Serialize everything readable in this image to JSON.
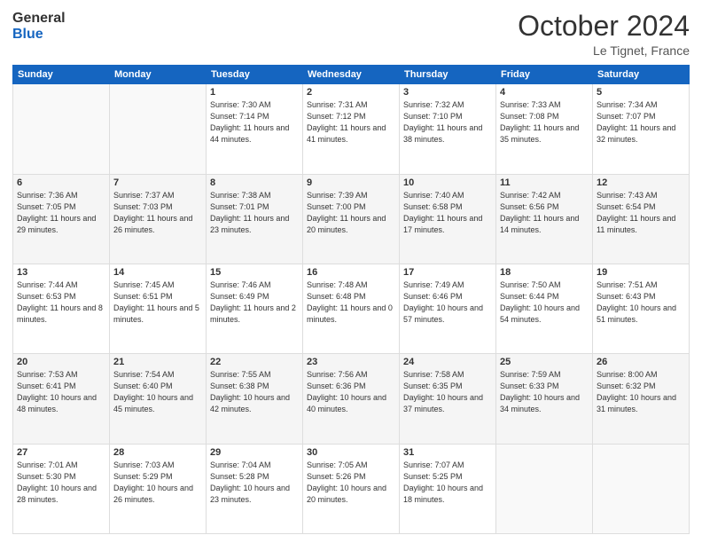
{
  "header": {
    "logo_general": "General",
    "logo_blue": "Blue",
    "month": "October 2024",
    "location": "Le Tignet, France"
  },
  "days_of_week": [
    "Sunday",
    "Monday",
    "Tuesday",
    "Wednesday",
    "Thursday",
    "Friday",
    "Saturday"
  ],
  "weeks": [
    [
      {
        "num": "",
        "sunrise": "",
        "sunset": "",
        "daylight": "",
        "empty": true
      },
      {
        "num": "",
        "sunrise": "",
        "sunset": "",
        "daylight": "",
        "empty": true
      },
      {
        "num": "1",
        "sunrise": "Sunrise: 7:30 AM",
        "sunset": "Sunset: 7:14 PM",
        "daylight": "Daylight: 11 hours and 44 minutes.",
        "empty": false
      },
      {
        "num": "2",
        "sunrise": "Sunrise: 7:31 AM",
        "sunset": "Sunset: 7:12 PM",
        "daylight": "Daylight: 11 hours and 41 minutes.",
        "empty": false
      },
      {
        "num": "3",
        "sunrise": "Sunrise: 7:32 AM",
        "sunset": "Sunset: 7:10 PM",
        "daylight": "Daylight: 11 hours and 38 minutes.",
        "empty": false
      },
      {
        "num": "4",
        "sunrise": "Sunrise: 7:33 AM",
        "sunset": "Sunset: 7:08 PM",
        "daylight": "Daylight: 11 hours and 35 minutes.",
        "empty": false
      },
      {
        "num": "5",
        "sunrise": "Sunrise: 7:34 AM",
        "sunset": "Sunset: 7:07 PM",
        "daylight": "Daylight: 11 hours and 32 minutes.",
        "empty": false
      }
    ],
    [
      {
        "num": "6",
        "sunrise": "Sunrise: 7:36 AM",
        "sunset": "Sunset: 7:05 PM",
        "daylight": "Daylight: 11 hours and 29 minutes.",
        "empty": false
      },
      {
        "num": "7",
        "sunrise": "Sunrise: 7:37 AM",
        "sunset": "Sunset: 7:03 PM",
        "daylight": "Daylight: 11 hours and 26 minutes.",
        "empty": false
      },
      {
        "num": "8",
        "sunrise": "Sunrise: 7:38 AM",
        "sunset": "Sunset: 7:01 PM",
        "daylight": "Daylight: 11 hours and 23 minutes.",
        "empty": false
      },
      {
        "num": "9",
        "sunrise": "Sunrise: 7:39 AM",
        "sunset": "Sunset: 7:00 PM",
        "daylight": "Daylight: 11 hours and 20 minutes.",
        "empty": false
      },
      {
        "num": "10",
        "sunrise": "Sunrise: 7:40 AM",
        "sunset": "Sunset: 6:58 PM",
        "daylight": "Daylight: 11 hours and 17 minutes.",
        "empty": false
      },
      {
        "num": "11",
        "sunrise": "Sunrise: 7:42 AM",
        "sunset": "Sunset: 6:56 PM",
        "daylight": "Daylight: 11 hours and 14 minutes.",
        "empty": false
      },
      {
        "num": "12",
        "sunrise": "Sunrise: 7:43 AM",
        "sunset": "Sunset: 6:54 PM",
        "daylight": "Daylight: 11 hours and 11 minutes.",
        "empty": false
      }
    ],
    [
      {
        "num": "13",
        "sunrise": "Sunrise: 7:44 AM",
        "sunset": "Sunset: 6:53 PM",
        "daylight": "Daylight: 11 hours and 8 minutes.",
        "empty": false
      },
      {
        "num": "14",
        "sunrise": "Sunrise: 7:45 AM",
        "sunset": "Sunset: 6:51 PM",
        "daylight": "Daylight: 11 hours and 5 minutes.",
        "empty": false
      },
      {
        "num": "15",
        "sunrise": "Sunrise: 7:46 AM",
        "sunset": "Sunset: 6:49 PM",
        "daylight": "Daylight: 11 hours and 2 minutes.",
        "empty": false
      },
      {
        "num": "16",
        "sunrise": "Sunrise: 7:48 AM",
        "sunset": "Sunset: 6:48 PM",
        "daylight": "Daylight: 11 hours and 0 minutes.",
        "empty": false
      },
      {
        "num": "17",
        "sunrise": "Sunrise: 7:49 AM",
        "sunset": "Sunset: 6:46 PM",
        "daylight": "Daylight: 10 hours and 57 minutes.",
        "empty": false
      },
      {
        "num": "18",
        "sunrise": "Sunrise: 7:50 AM",
        "sunset": "Sunset: 6:44 PM",
        "daylight": "Daylight: 10 hours and 54 minutes.",
        "empty": false
      },
      {
        "num": "19",
        "sunrise": "Sunrise: 7:51 AM",
        "sunset": "Sunset: 6:43 PM",
        "daylight": "Daylight: 10 hours and 51 minutes.",
        "empty": false
      }
    ],
    [
      {
        "num": "20",
        "sunrise": "Sunrise: 7:53 AM",
        "sunset": "Sunset: 6:41 PM",
        "daylight": "Daylight: 10 hours and 48 minutes.",
        "empty": false
      },
      {
        "num": "21",
        "sunrise": "Sunrise: 7:54 AM",
        "sunset": "Sunset: 6:40 PM",
        "daylight": "Daylight: 10 hours and 45 minutes.",
        "empty": false
      },
      {
        "num": "22",
        "sunrise": "Sunrise: 7:55 AM",
        "sunset": "Sunset: 6:38 PM",
        "daylight": "Daylight: 10 hours and 42 minutes.",
        "empty": false
      },
      {
        "num": "23",
        "sunrise": "Sunrise: 7:56 AM",
        "sunset": "Sunset: 6:36 PM",
        "daylight": "Daylight: 10 hours and 40 minutes.",
        "empty": false
      },
      {
        "num": "24",
        "sunrise": "Sunrise: 7:58 AM",
        "sunset": "Sunset: 6:35 PM",
        "daylight": "Daylight: 10 hours and 37 minutes.",
        "empty": false
      },
      {
        "num": "25",
        "sunrise": "Sunrise: 7:59 AM",
        "sunset": "Sunset: 6:33 PM",
        "daylight": "Daylight: 10 hours and 34 minutes.",
        "empty": false
      },
      {
        "num": "26",
        "sunrise": "Sunrise: 8:00 AM",
        "sunset": "Sunset: 6:32 PM",
        "daylight": "Daylight: 10 hours and 31 minutes.",
        "empty": false
      }
    ],
    [
      {
        "num": "27",
        "sunrise": "Sunrise: 7:01 AM",
        "sunset": "Sunset: 5:30 PM",
        "daylight": "Daylight: 10 hours and 28 minutes.",
        "empty": false
      },
      {
        "num": "28",
        "sunrise": "Sunrise: 7:03 AM",
        "sunset": "Sunset: 5:29 PM",
        "daylight": "Daylight: 10 hours and 26 minutes.",
        "empty": false
      },
      {
        "num": "29",
        "sunrise": "Sunrise: 7:04 AM",
        "sunset": "Sunset: 5:28 PM",
        "daylight": "Daylight: 10 hours and 23 minutes.",
        "empty": false
      },
      {
        "num": "30",
        "sunrise": "Sunrise: 7:05 AM",
        "sunset": "Sunset: 5:26 PM",
        "daylight": "Daylight: 10 hours and 20 minutes.",
        "empty": false
      },
      {
        "num": "31",
        "sunrise": "Sunrise: 7:07 AM",
        "sunset": "Sunset: 5:25 PM",
        "daylight": "Daylight: 10 hours and 18 minutes.",
        "empty": false
      },
      {
        "num": "",
        "sunrise": "",
        "sunset": "",
        "daylight": "",
        "empty": true
      },
      {
        "num": "",
        "sunrise": "",
        "sunset": "",
        "daylight": "",
        "empty": true
      }
    ]
  ]
}
